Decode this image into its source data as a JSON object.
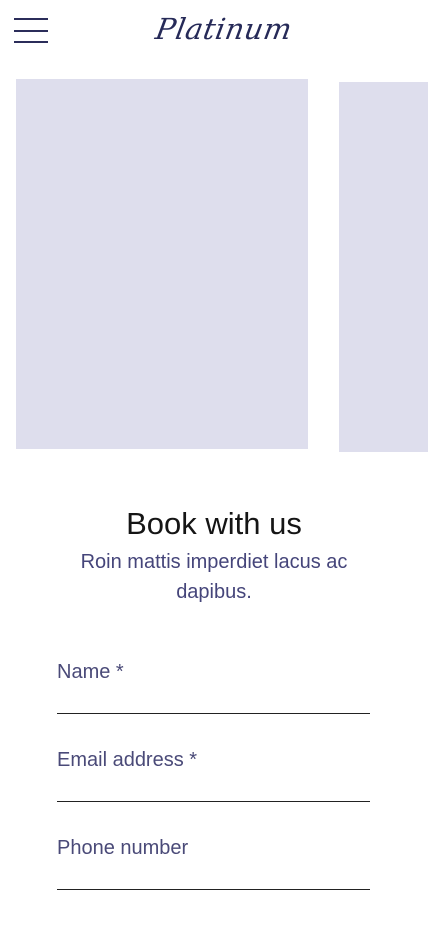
{
  "header": {
    "logo_text": "Platinum",
    "menu_icon": "hamburger-menu-icon"
  },
  "gallery": {
    "items": [
      {
        "color": "#dedeed"
      },
      {
        "color": "#dedeed"
      }
    ]
  },
  "booking": {
    "title": "Book with us",
    "subtitle": "Roin mattis imperdiet lacus ac dapibus.",
    "fields": {
      "name": {
        "label": "Name *",
        "value": ""
      },
      "email": {
        "label": "Email address *",
        "value": ""
      },
      "phone": {
        "label": "Phone number",
        "value": ""
      }
    }
  },
  "colors": {
    "accent": "#262a58",
    "text_muted": "#45457a",
    "placeholder_block": "#dedeed"
  }
}
